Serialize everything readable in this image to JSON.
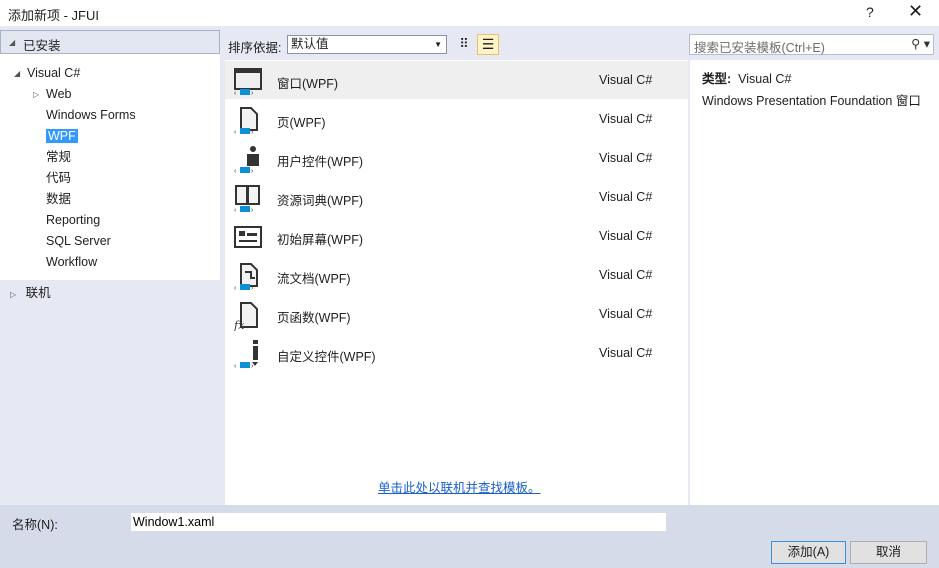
{
  "window": {
    "title": "添加新项 - JFUI",
    "help": "?",
    "close": "✕"
  },
  "sidebar": {
    "installed": "已安装",
    "items": [
      {
        "label": "Visual C#",
        "level": 0,
        "expander": "expanded"
      },
      {
        "label": "Web",
        "level": 1,
        "expander": "collapsed"
      },
      {
        "label": "Windows Forms",
        "level": 1
      },
      {
        "label": "WPF",
        "level": 1,
        "selected": true
      },
      {
        "label": "常规",
        "level": 1
      },
      {
        "label": "代码",
        "level": 1
      },
      {
        "label": "数据",
        "level": 1
      },
      {
        "label": "Reporting",
        "level": 1
      },
      {
        "label": "SQL Server",
        "level": 1
      },
      {
        "label": "Workflow",
        "level": 1
      }
    ],
    "online": "联机"
  },
  "toolbar": {
    "sort_label": "排序依据:",
    "sort_value": "默认值",
    "search_placeholder": "搜索已安装模板(Ctrl+E)"
  },
  "templates": [
    {
      "name": "窗口(WPF)",
      "lang": "Visual C#",
      "icon": "window-icon",
      "selected": true
    },
    {
      "name": "页(WPF)",
      "lang": "Visual C#",
      "icon": "page-icon"
    },
    {
      "name": "用户控件(WPF)",
      "lang": "Visual C#",
      "icon": "user-control-icon"
    },
    {
      "name": "资源词典(WPF)",
      "lang": "Visual C#",
      "icon": "resource-dictionary-icon"
    },
    {
      "name": "初始屏幕(WPF)",
      "lang": "Visual C#",
      "icon": "splash-screen-icon"
    },
    {
      "name": "流文档(WPF)",
      "lang": "Visual C#",
      "icon": "flow-document-icon"
    },
    {
      "name": "页函数(WPF)",
      "lang": "Visual C#",
      "icon": "page-function-icon"
    },
    {
      "name": "自定义控件(WPF)",
      "lang": "Visual C#",
      "icon": "custom-control-icon"
    }
  ],
  "online_link": "单击此处以联机并查找模板。",
  "details": {
    "type_label": "类型:",
    "type_value": "Visual C#",
    "description": "Windows Presentation Foundation 窗口"
  },
  "footer": {
    "name_label": "名称(N):",
    "name_value": "Window1.xaml",
    "add": "添加(A)",
    "cancel": "取消"
  },
  "colors": {
    "accent": "#3399ff",
    "icon_blue": "#0e8fd6"
  }
}
